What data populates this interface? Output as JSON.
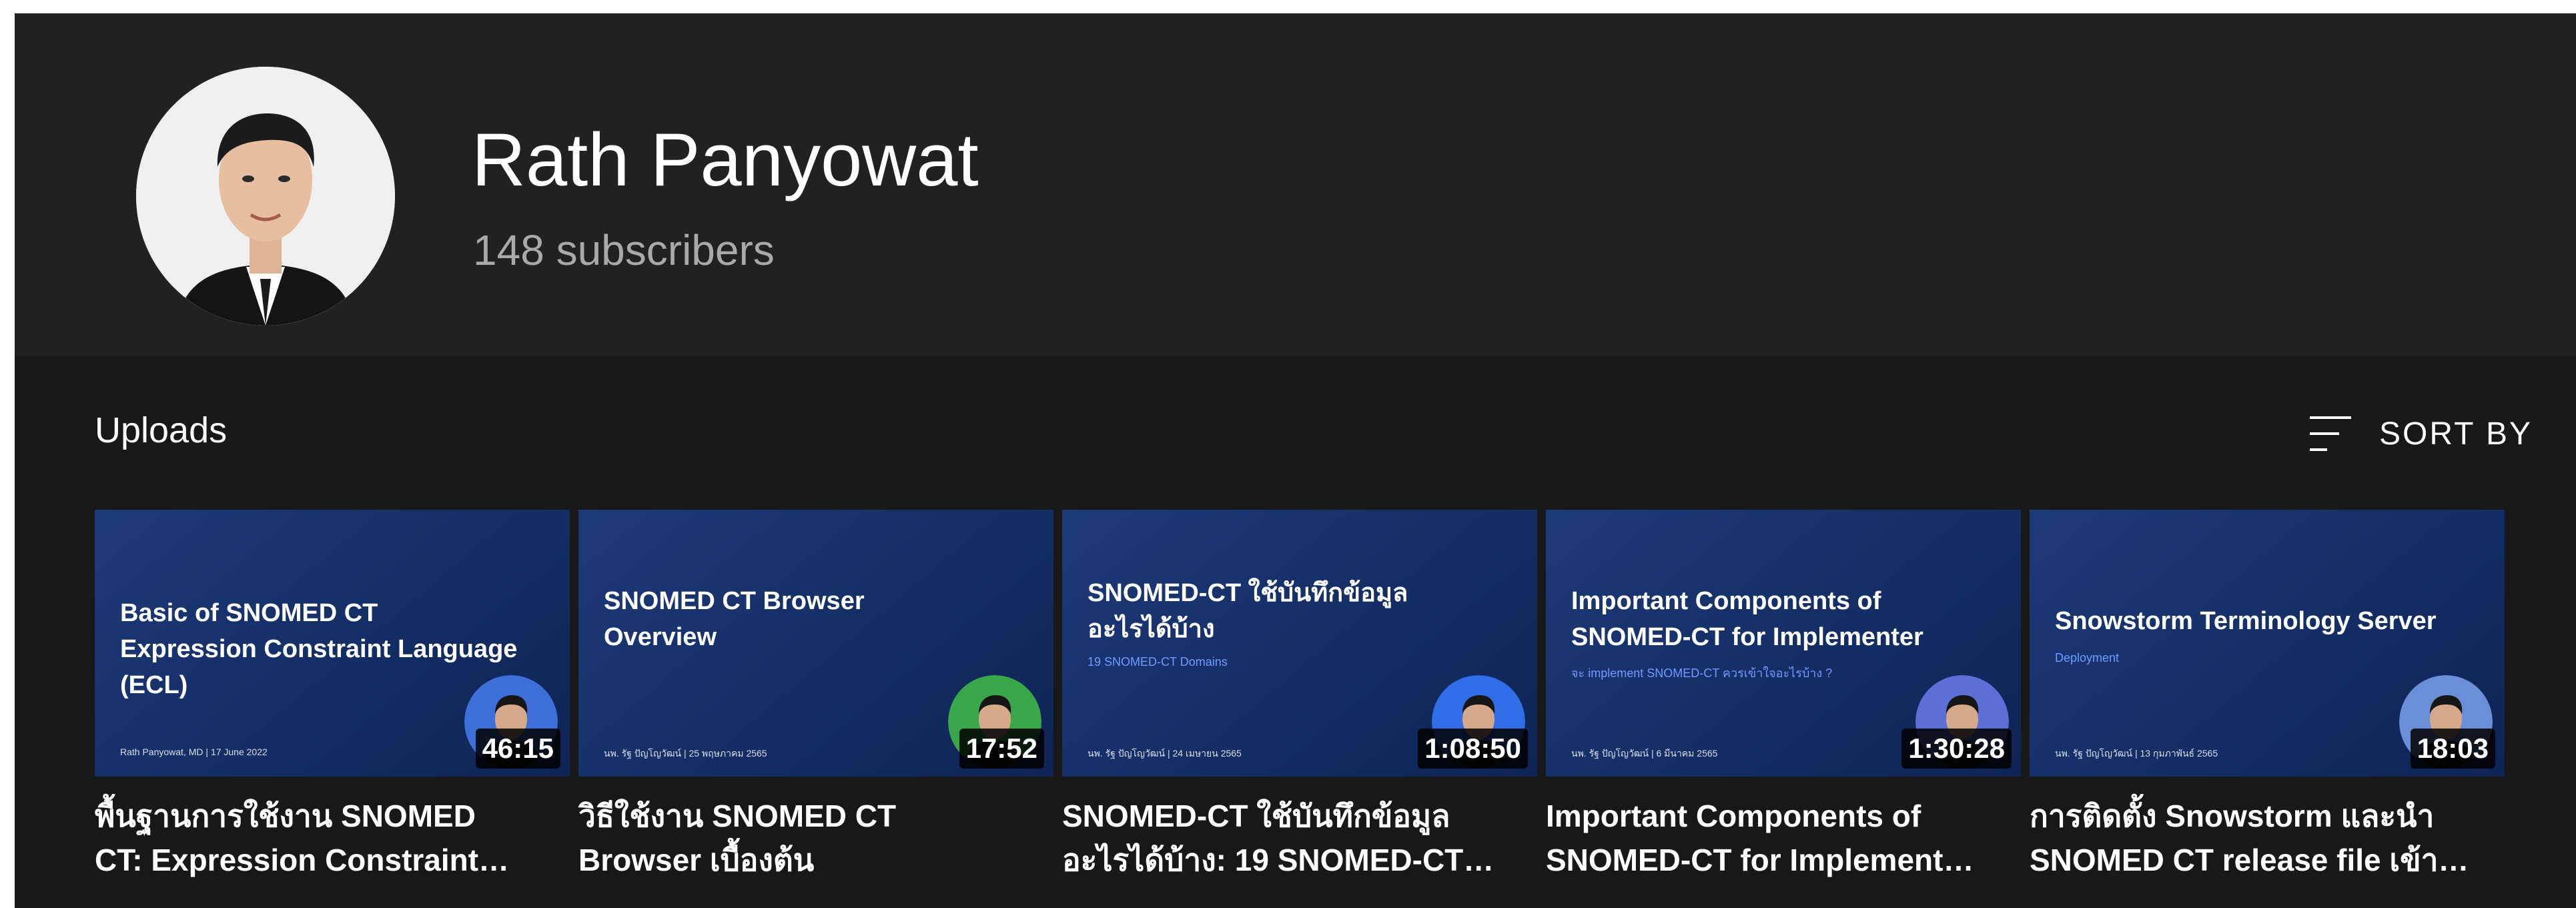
{
  "channel": {
    "name": "Rath Panyowat",
    "subscribers": "148 subscribers"
  },
  "uploads": {
    "title": "Uploads",
    "sort_label": "SORT BY"
  },
  "videos": [
    {
      "thumb_title": "Basic of SNOMED CT\nExpression Constraint Language (ECL)",
      "thumb_sub": "",
      "thumb_footer": "Rath Panyowat, MD | 17 June 2022",
      "duration": "46:15",
      "title": "พื้นฐานการใช้งาน SNOMED\nCT: Expression Constraint…",
      "presenter_bg": "#3e6fd8"
    },
    {
      "thumb_title": "SNOMED CT Browser\nOverview",
      "thumb_sub": "",
      "thumb_footer": "นพ. รัฐ ปัญโญวัฒน์ | 25 พฤษภาคม 2565",
      "duration": "17:52",
      "title": "วิธีใช้งาน SNOMED CT\nBrowser เบื้องต้น",
      "presenter_bg": "#3aa64a"
    },
    {
      "thumb_title": "SNOMED-CT ใช้บันทึกข้อมูล\nอะไรได้บ้าง",
      "thumb_sub": "19 SNOMED-CT Domains",
      "thumb_footer": "นพ. รัฐ ปัญโญวัฒน์ | 24 เมษายน 2565",
      "duration": "1:08:50",
      "title": "SNOMED-CT ใช้บันทึกข้อมูล\nอะไรได้บ้าง: 19 SNOMED-CT…",
      "presenter_bg": "#2f6ee6"
    },
    {
      "thumb_title": "Important Components of\nSNOMED-CT for Implementer",
      "thumb_sub": "จะ implement SNOMED-CT ควรเข้าใจอะไรบ้าง ?",
      "thumb_footer": "นพ. รัฐ ปัญโญวัฒน์ | 6 มีนาคม 2565",
      "duration": "1:30:28",
      "title": "Important Components of\nSNOMED-CT for Implement…",
      "presenter_bg": "#5b6fd6"
    },
    {
      "thumb_title": "Snowstorm Terminology Server",
      "thumb_sub": "Deployment",
      "thumb_footer": "นพ. รัฐ ปัญโญวัฒน์ | 13 กุมภาพันธ์ 2565",
      "duration": "18:03",
      "title": "การติดตั้ง Snowstorm และนำ\nSNOMED CT release file เข้า…",
      "presenter_bg": "#6a8fd8"
    }
  ]
}
